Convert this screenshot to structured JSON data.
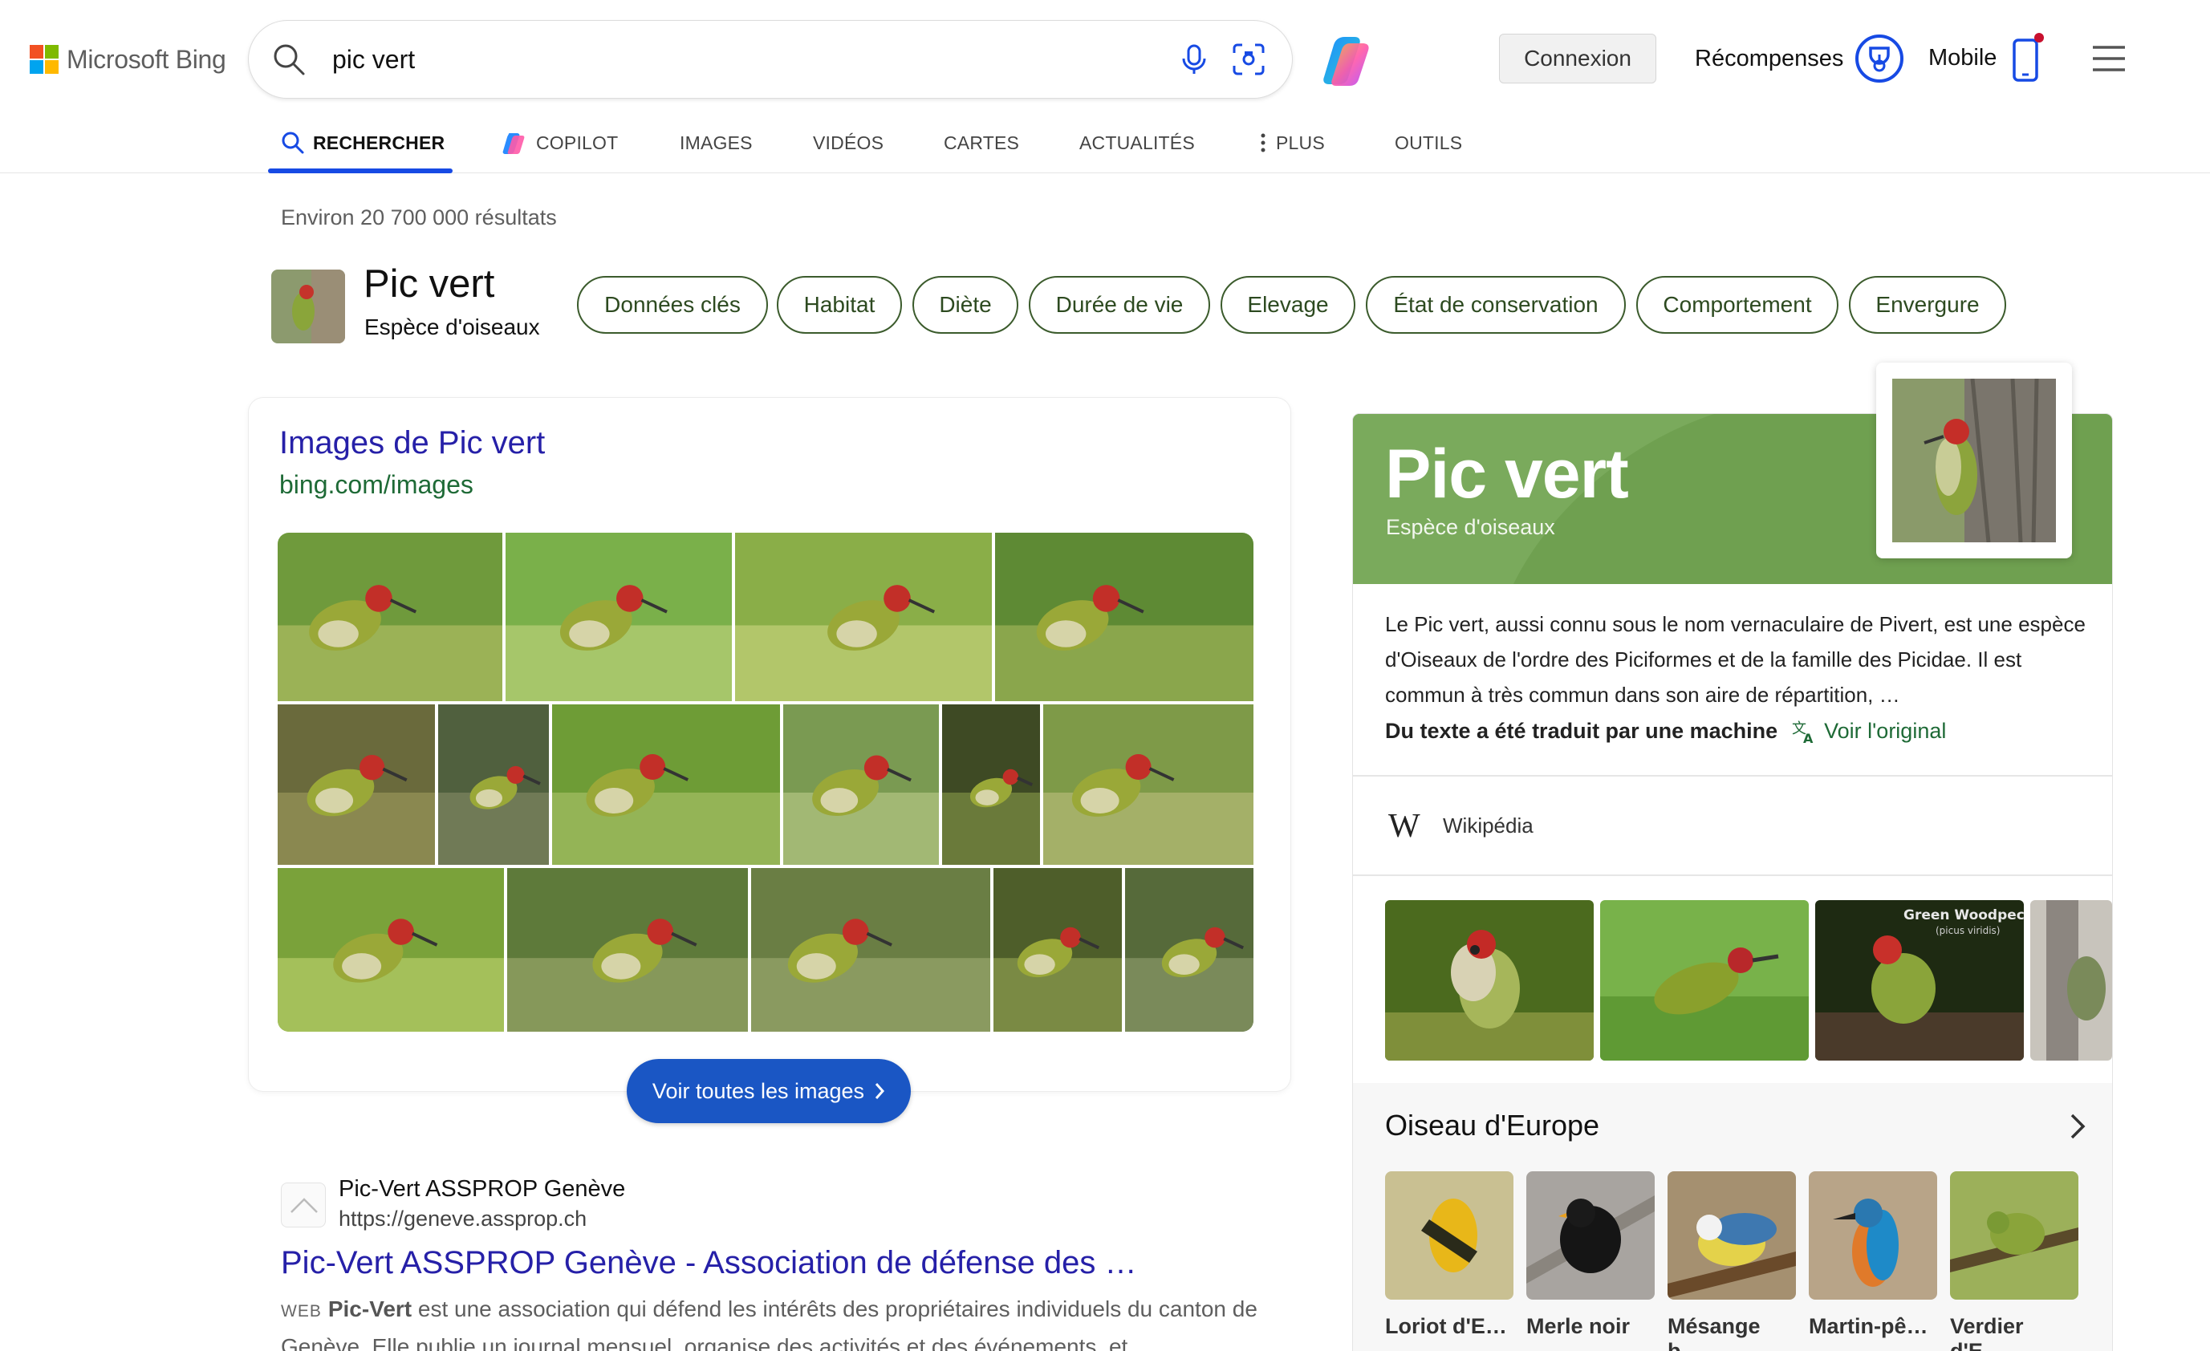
{
  "header": {
    "logo_text": "Microsoft Bing",
    "search_query": "pic vert",
    "signin_label": "Connexion",
    "rewards_label": "Récompenses",
    "mobile_label": "Mobile",
    "icons": [
      "search-icon",
      "microphone-icon",
      "visual-search-icon",
      "copilot-icon",
      "rewards-icon",
      "mobile-phone-icon",
      "hamburger-menu-icon"
    ]
  },
  "nav": {
    "tabs": [
      {
        "label": "RECHERCHER",
        "active": true
      },
      {
        "label": "COPILOT"
      },
      {
        "label": "IMAGES"
      },
      {
        "label": "VIDÉOS"
      },
      {
        "label": "CARTES"
      },
      {
        "label": "ACTUALITÉS"
      },
      {
        "label": "PLUS"
      },
      {
        "label": "OUTILS"
      }
    ]
  },
  "results_count": "Environ 20 700 000 résultats",
  "entity": {
    "title": "Pic vert",
    "subtitle": "Espèce d'oiseaux",
    "chips": [
      "Données clés",
      "Habitat",
      "Diète",
      "Durée de vie",
      "Elevage",
      "État de conservation",
      "Comportement",
      "Envergure"
    ]
  },
  "images_card": {
    "title": "Images de Pic vert",
    "url": "bing.com/images",
    "button_label": "Voir toutes les images"
  },
  "result": {
    "site_name": "Pic-Vert ASSPROP Genève",
    "url": "https://geneve.assprop.ch",
    "title": "Pic-Vert ASSPROP Genève - Association de défense des …",
    "tag": "WEB",
    "snippet_bold": "Pic-Vert",
    "snippet_rest": " est une association qui défend les intérêts des propriétaires individuels du canton de Genève. Elle publie un journal mensuel, organise des activités et des événements, et …"
  },
  "knowledge_panel": {
    "title": "Pic vert",
    "subtitle": "Espèce d'oiseaux",
    "description": "Le Pic vert, aussi connu sous le nom vernaculaire de Pivert, est une espèce d'Oiseaux de l'ordre des Piciformes et de la famille des Picidae. Il est commun à très commun dans son aire de répartition, …",
    "machine_translation": "Du texte a été traduit par une machine",
    "view_original": "Voir l'original",
    "source": "Wikipédia",
    "source_icon": "W",
    "image_caption": "Green Woodpec",
    "image_caption2": "(picus viridis)",
    "related_title": "Oiseau d'Europe",
    "related": [
      "Loriot d'E…",
      "Merle noir",
      "Mésange b…",
      "Martin-pê…",
      "Verdier d'E…"
    ]
  },
  "colors": {
    "accent_blue": "#174ae4",
    "link_purple": "#2620a8",
    "url_green": "#1e6a36",
    "panel_green": "#6fa050",
    "button_blue": "#1a56c4"
  }
}
